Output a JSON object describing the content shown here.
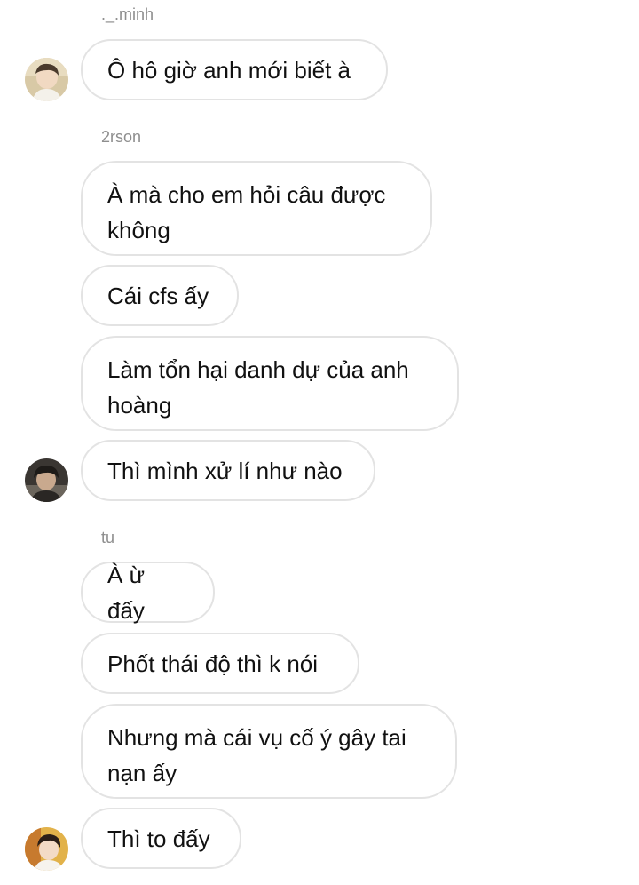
{
  "groups": [
    {
      "sender": "._.minh",
      "messages": [
        "Ô hô giờ anh mới biết à"
      ],
      "avatar_icon": "user-avatar-icon"
    },
    {
      "sender": "2rson",
      "messages": [
        "À mà cho em hỏi câu được\nkhông",
        "Cái cfs ấy",
        "Làm tổn hại danh dự của anh\nhoàng",
        "Thì mình xử lí như nào"
      ],
      "avatar_icon": "user-avatar-icon"
    },
    {
      "sender": "tu",
      "messages": [
        "À ừ đấy",
        "Phốt thái độ thì k nói",
        "Nhưng mà cái vụ cố ý gây tai\nnạn ấy",
        "Thì to đấy"
      ],
      "avatar_icon": "user-avatar-icon"
    }
  ],
  "colors": {
    "bubble_border": "#e3e3e3",
    "sender_text": "#8e8e8e",
    "message_text": "#111111"
  }
}
